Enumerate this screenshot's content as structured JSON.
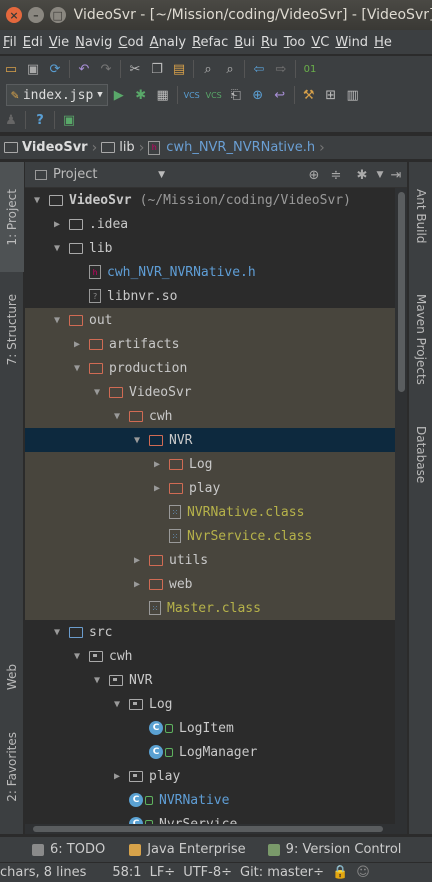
{
  "window": {
    "title": "VideoSvr - [~/Mission/coding/VideoSvr] - [VideoSvr]"
  },
  "menu": [
    "Fil",
    "Edi",
    "Vie",
    "Navig",
    "Cod",
    "Analy",
    "Refac",
    "Bui",
    "Ru",
    "Too",
    "VC",
    "Wind",
    "He"
  ],
  "toolbar": {
    "run_config": "index.jsp"
  },
  "breadcrumb": [
    "VideoSvr",
    "lib",
    "cwh_NVR_NVRNative.h"
  ],
  "panel": {
    "view": "Project"
  },
  "tree": [
    {
      "label": "VideoSvr",
      "path": "(~/Mission/coding/VideoSvr)",
      "depth": 0,
      "twisty": "open",
      "icon": "folder",
      "style": "root"
    },
    {
      "label": ".idea",
      "depth": 1,
      "twisty": "closed",
      "icon": "folder"
    },
    {
      "label": "lib",
      "depth": 1,
      "twisty": "open",
      "icon": "folder"
    },
    {
      "label": "cwh_NVR_NVRNative.h",
      "depth": 2,
      "twisty": "none",
      "icon": "h-file",
      "style": "blue"
    },
    {
      "label": "libnvr.so",
      "depth": 2,
      "twisty": "none",
      "icon": "file"
    },
    {
      "label": "out",
      "depth": 1,
      "twisty": "open",
      "icon": "folder-red",
      "excluded": true
    },
    {
      "label": "artifacts",
      "depth": 2,
      "twisty": "closed",
      "icon": "folder-red",
      "excluded": true
    },
    {
      "label": "production",
      "depth": 2,
      "twisty": "open",
      "icon": "folder-red",
      "excluded": true
    },
    {
      "label": "VideoSvr",
      "depth": 3,
      "twisty": "open",
      "icon": "folder-red",
      "excluded": true
    },
    {
      "label": "cwh",
      "depth": 4,
      "twisty": "open",
      "icon": "folder-red",
      "excluded": true
    },
    {
      "label": "NVR",
      "depth": 5,
      "twisty": "open",
      "icon": "folder-red",
      "selected": true
    },
    {
      "label": "Log",
      "depth": 6,
      "twisty": "closed",
      "icon": "folder-red",
      "excluded": true
    },
    {
      "label": "play",
      "depth": 6,
      "twisty": "closed",
      "icon": "folder-red",
      "excluded": true
    },
    {
      "label": "NVRNative.class",
      "depth": 6,
      "twisty": "none",
      "icon": "class-file",
      "style": "olive",
      "excluded": true
    },
    {
      "label": "NvrService.class",
      "depth": 6,
      "twisty": "none",
      "icon": "class-file",
      "style": "olive",
      "excluded": true
    },
    {
      "label": "utils",
      "depth": 5,
      "twisty": "closed",
      "icon": "folder-red",
      "excluded": true
    },
    {
      "label": "web",
      "depth": 5,
      "twisty": "closed",
      "icon": "folder-red",
      "excluded": true
    },
    {
      "label": "Master.class",
      "depth": 5,
      "twisty": "none",
      "icon": "class-file",
      "style": "olive",
      "excluded": true
    },
    {
      "label": "src",
      "depth": 1,
      "twisty": "open",
      "icon": "folder-blue"
    },
    {
      "label": "cwh",
      "depth": 2,
      "twisty": "open",
      "icon": "package"
    },
    {
      "label": "NVR",
      "depth": 3,
      "twisty": "open",
      "icon": "package"
    },
    {
      "label": "Log",
      "depth": 4,
      "twisty": "open",
      "icon": "package"
    },
    {
      "label": "LogItem",
      "depth": 5,
      "twisty": "none",
      "icon": "class"
    },
    {
      "label": "LogManager",
      "depth": 5,
      "twisty": "none",
      "icon": "class"
    },
    {
      "label": "play",
      "depth": 4,
      "twisty": "closed",
      "icon": "package"
    },
    {
      "label": "NVRNative",
      "depth": 4,
      "twisty": "none",
      "icon": "class",
      "style": "blue"
    },
    {
      "label": "NvrService",
      "depth": 4,
      "twisty": "none",
      "icon": "class"
    }
  ],
  "side_tabs": {
    "left": {
      "project": "1: Project",
      "structure": "7: Structure",
      "web": "Web",
      "favorites": "2: Favorites"
    },
    "right": {
      "ant": "Ant Build",
      "maven": "Maven Projects",
      "database": "Database"
    }
  },
  "bottom_tabs": {
    "todo": "6: TODO",
    "java_enterprise": "Java Enterprise",
    "vcs": "9: Version Control"
  },
  "status": {
    "selection": "chars, 8 lines",
    "position": "58:1",
    "line_sep": "LF÷",
    "encoding": "UTF-8÷",
    "git": "Git: master÷"
  },
  "colors": {
    "selected_row": "#0d293e",
    "excluded_bg": "#48453d",
    "accent_blue": "#5f9ed6",
    "class_olive": "#b6b24a"
  }
}
